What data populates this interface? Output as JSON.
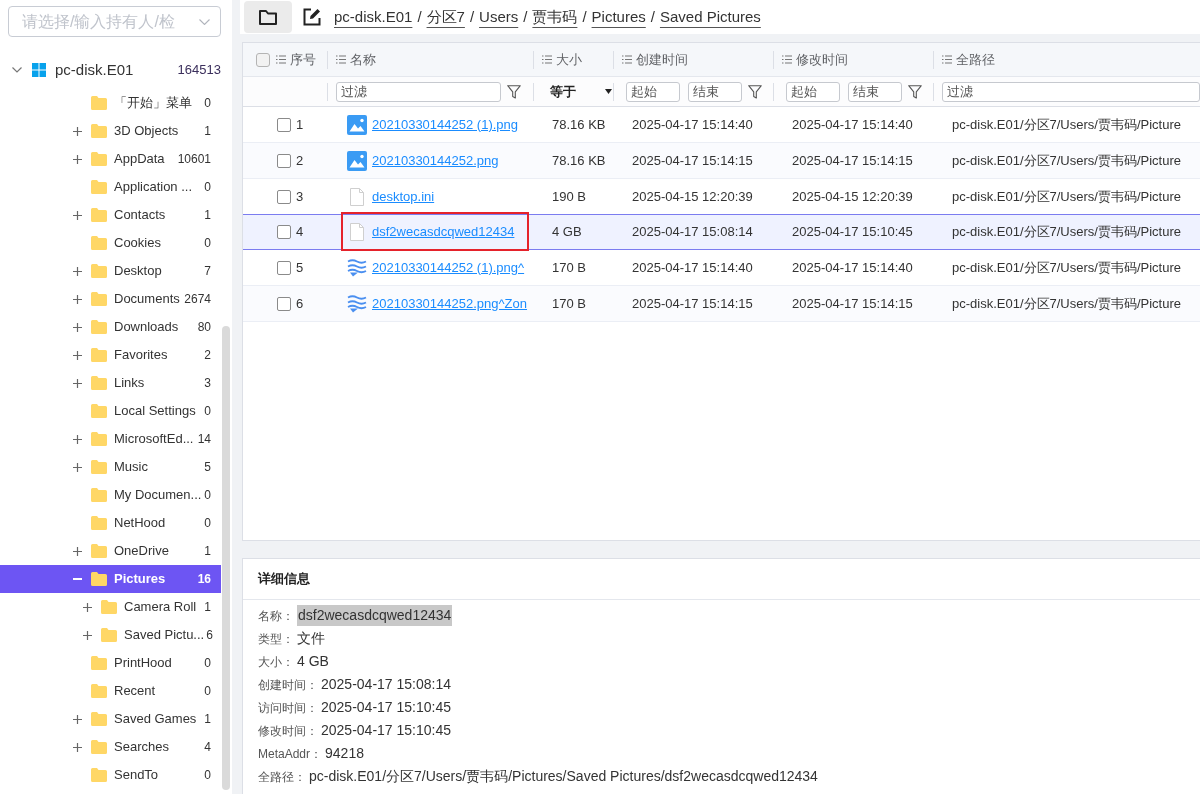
{
  "owner_select": {
    "placeholder": "请选择/输入持有人/检"
  },
  "tree": {
    "root": {
      "label": "pc-disk.E01",
      "count": "164513",
      "expanded": true,
      "selected": false,
      "children": [
        {
          "label": "「开始」菜单",
          "count": "0",
          "selected": false
        },
        {
          "label": "3D Objects",
          "count": "1",
          "expanded": false,
          "selected": false
        },
        {
          "label": "AppData",
          "count": "10601",
          "expanded": false,
          "selected": false
        },
        {
          "label": "Application ...",
          "count": "0",
          "selected": false
        },
        {
          "label": "Contacts",
          "count": "1",
          "expanded": false,
          "selected": false
        },
        {
          "label": "Cookies",
          "count": "0",
          "selected": false
        },
        {
          "label": "Desktop",
          "count": "7",
          "expanded": false,
          "selected": false
        },
        {
          "label": "Documents",
          "count": "2674",
          "expanded": false,
          "selected": false
        },
        {
          "label": "Downloads",
          "count": "80",
          "expanded": false,
          "selected": false
        },
        {
          "label": "Favorites",
          "count": "2",
          "expanded": false,
          "selected": false
        },
        {
          "label": "Links",
          "count": "3",
          "expanded": false,
          "selected": false
        },
        {
          "label": "Local Settings",
          "count": "0",
          "selected": false
        },
        {
          "label": "MicrosoftEd...",
          "count": "14",
          "expanded": false,
          "selected": false
        },
        {
          "label": "Music",
          "count": "5",
          "expanded": false,
          "selected": false
        },
        {
          "label": "My Documen...",
          "count": "0",
          "selected": false
        },
        {
          "label": "NetHood",
          "count": "0",
          "selected": false
        },
        {
          "label": "OneDrive",
          "count": "1",
          "expanded": false,
          "selected": false
        },
        {
          "label": "Pictures",
          "count": "16",
          "expanded": true,
          "selected": true,
          "children": [
            {
              "label": "Camera Roll",
              "count": "1",
              "expanded": false,
              "selected": false
            },
            {
              "label": "Saved Pictu...",
              "count": "6",
              "expanded": false,
              "selected": false
            }
          ]
        },
        {
          "label": "PrintHood",
          "count": "0",
          "selected": false
        },
        {
          "label": "Recent",
          "count": "0",
          "selected": false
        },
        {
          "label": "Saved Games",
          "count": "1",
          "expanded": false,
          "selected": false
        },
        {
          "label": "Searches",
          "count": "4",
          "expanded": false,
          "selected": false
        },
        {
          "label": "SendTo",
          "count": "0",
          "selected": false
        }
      ]
    }
  },
  "toolbar": {
    "breadcrumb": [
      "pc-disk.E01",
      "分区7",
      "Users",
      "贾韦码",
      "Pictures",
      "Saved Pictures"
    ],
    "separator": "/"
  },
  "table": {
    "select_all": {
      "checked": false
    },
    "columns": [
      {
        "label": "序号"
      },
      {
        "label": "名称",
        "filter": {
          "kind": "text",
          "placeholder": "过滤",
          "button": true
        }
      },
      {
        "label": "大小",
        "filter": {
          "kind": "select",
          "value": "等于"
        }
      },
      {
        "label": "创建时间",
        "filter": {
          "kind": "range",
          "from_placeholder": "起始",
          "to_placeholder": "结束",
          "button": true
        }
      },
      {
        "label": "修改时间",
        "filter": {
          "kind": "range",
          "from_placeholder": "起始",
          "to_placeholder": "结束",
          "button": true
        }
      },
      {
        "label": "全路径",
        "filter": {
          "kind": "text",
          "placeholder": "过滤"
        }
      }
    ],
    "rows": [
      {
        "index": "1",
        "checked": false,
        "selected": false,
        "outlined": false,
        "kind": "image",
        "name": "20210330144252 (1).png",
        "size": "78.16 KB",
        "created": "2025-04-17 15:14:40",
        "modified": "2025-04-17 15:14:40",
        "path": "pc-disk.E01/分区7/Users/贾韦码/Picture"
      },
      {
        "index": "2",
        "checked": false,
        "selected": false,
        "outlined": false,
        "kind": "image",
        "name": "20210330144252.png",
        "size": "78.16 KB",
        "created": "2025-04-17 15:14:15",
        "modified": "2025-04-17 15:14:15",
        "path": "pc-disk.E01/分区7/Users/贾韦码/Picture"
      },
      {
        "index": "3",
        "checked": false,
        "selected": false,
        "outlined": false,
        "kind": "file",
        "name": "desktop.ini",
        "size": "190 B",
        "created": "2025-04-15 12:20:39",
        "modified": "2025-04-15 12:20:39",
        "path": "pc-disk.E01/分区7/Users/贾韦码/Picture"
      },
      {
        "index": "4",
        "checked": false,
        "selected": true,
        "outlined": true,
        "kind": "file",
        "name": "dsf2wecasdcqwed12434",
        "size": "4 GB",
        "created": "2025-04-17 15:08:14",
        "modified": "2025-04-17 15:10:45",
        "path": "pc-disk.E01/分区7/Users/贾韦码/Picture"
      },
      {
        "index": "5",
        "checked": false,
        "selected": false,
        "outlined": false,
        "kind": "stream",
        "name": "20210330144252 (1).png^",
        "size": "170 B",
        "created": "2025-04-17 15:14:40",
        "modified": "2025-04-17 15:14:40",
        "path": "pc-disk.E01/分区7/Users/贾韦码/Picture"
      },
      {
        "index": "6",
        "checked": false,
        "selected": false,
        "outlined": false,
        "kind": "stream",
        "name": "20210330144252.png^Zon",
        "size": "170 B",
        "created": "2025-04-17 15:14:15",
        "modified": "2025-04-17 15:14:15",
        "path": "pc-disk.E01/分区7/Users/贾韦码/Picture"
      }
    ]
  },
  "details": {
    "title": "详细信息",
    "fields": [
      {
        "label": "名称：",
        "value": "dsf2wecasdcqwed12434",
        "highlighted": true
      },
      {
        "label": "类型：",
        "value": "文件",
        "highlighted": false
      },
      {
        "label": "大小：",
        "value": "4 GB",
        "highlighted": false
      },
      {
        "label": "创建时间：",
        "value": "2025-04-17 15:08:14",
        "highlighted": false
      },
      {
        "label": "访问时间：",
        "value": "2025-04-17 15:10:45",
        "highlighted": false
      },
      {
        "label": "修改时间：",
        "value": "2025-04-17 15:10:45",
        "highlighted": false
      },
      {
        "label": "MetaAddr：",
        "value": "94218",
        "highlighted": false
      },
      {
        "label": "全路径：",
        "value": "pc-disk.E01/分区7/Users/贾韦码/Pictures/Saved Pictures/dsf2wecasdcqwed12434",
        "highlighted": false
      }
    ]
  }
}
